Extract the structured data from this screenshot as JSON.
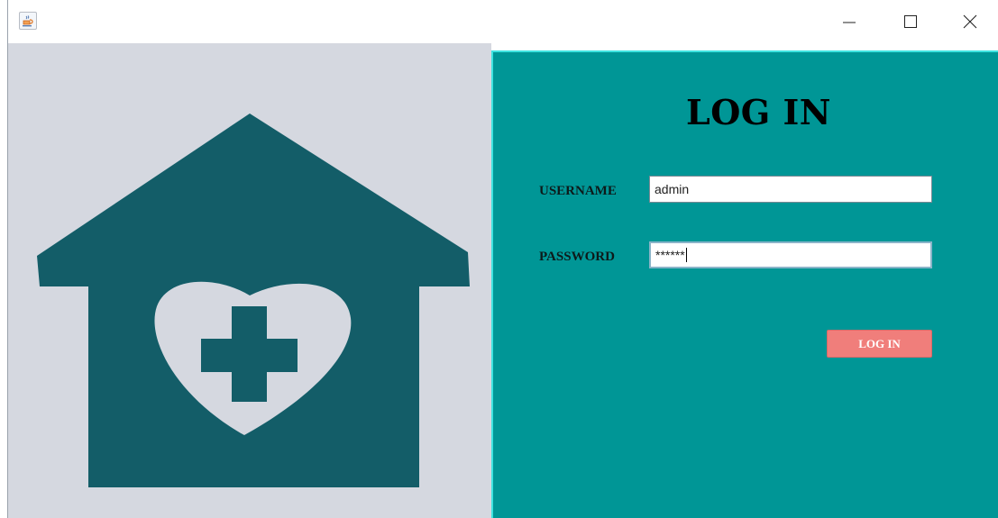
{
  "window": {
    "title": "",
    "controls": {
      "minimize_icon": "minimize-icon",
      "maximize_icon": "maximize-icon",
      "close_icon": "close-icon"
    }
  },
  "illustration": {
    "icon": "medical-house-heart-cross-icon",
    "colors": {
      "background": "#d5d8e0",
      "house": "#135d68"
    }
  },
  "login": {
    "title": "LOG IN",
    "username_label": "USERNAME",
    "username_value": "admin",
    "password_label": "PASSWORD",
    "password_value": "******",
    "button_label": "LOG IN",
    "colors": {
      "panel": "#009696",
      "panel_border": "#3fe3e0",
      "button": "#f07e7b"
    }
  }
}
